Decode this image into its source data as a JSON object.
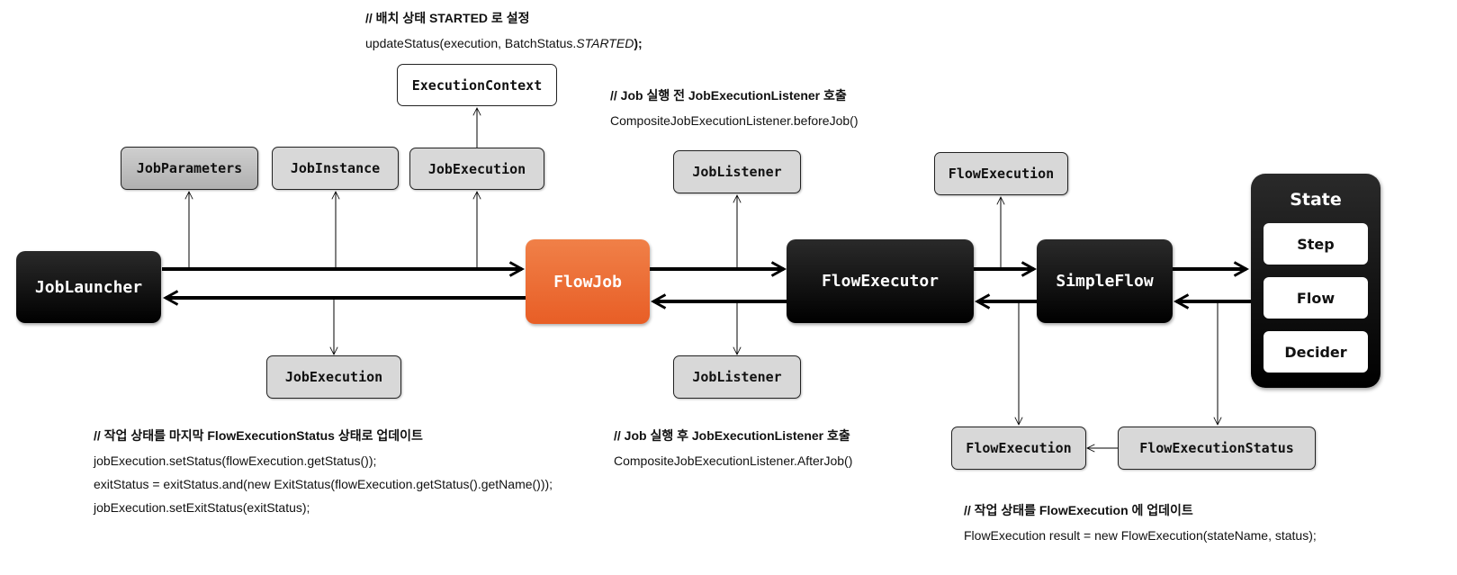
{
  "nodes": {
    "job_launcher": "JobLauncher",
    "flow_job": "FlowJob",
    "flow_executor": "FlowExecutor",
    "simple_flow": "SimpleFlow",
    "job_parameters": "JobParameters",
    "job_instance": "JobInstance",
    "job_execution_top": "JobExecution",
    "execution_context": "ExecutionContext",
    "job_execution_bottom": "JobExecution",
    "job_listener_top": "JobListener",
    "job_listener_bottom": "JobListener",
    "flow_execution_top": "FlowExecution",
    "flow_execution_bottom": "FlowExecution",
    "flow_execution_status": "FlowExecutionStatus"
  },
  "state": {
    "title": "State",
    "items": [
      "Step",
      "Flow",
      "Decider"
    ]
  },
  "notes": {
    "started": {
      "comment": "// 배치 상태 STARTED 로 설정",
      "code_prefix": "updateStatus(execution, BatchStatus.",
      "code_italic": "STARTED",
      "code_suffix": ");"
    },
    "before_job": {
      "comment": "// Job 실행 전 JobExecutionListener 호출",
      "code": "CompositeJobExecutionListener.beforeJob()"
    },
    "update_status": {
      "comment": "// 작업 상태를 마지막 FlowExecutionStatus 상태로 업데이트",
      "lines": [
        "jobExecution.setStatus(flowExecution.getStatus());",
        "exitStatus = exitStatus.and(new ExitStatus(flowExecution.getStatus().getName()));",
        "jobExecution.setExitStatus(exitStatus);"
      ]
    },
    "after_job": {
      "comment": "// Job 실행 후 JobExecutionListener 호출",
      "code": "CompositeJobExecutionListener.AfterJob()"
    },
    "flow_execution": {
      "comment": "// 작업 상태를 FlowExecution 에 업데이트",
      "code": "FlowExecution result = new FlowExecution(stateName, status);"
    }
  }
}
